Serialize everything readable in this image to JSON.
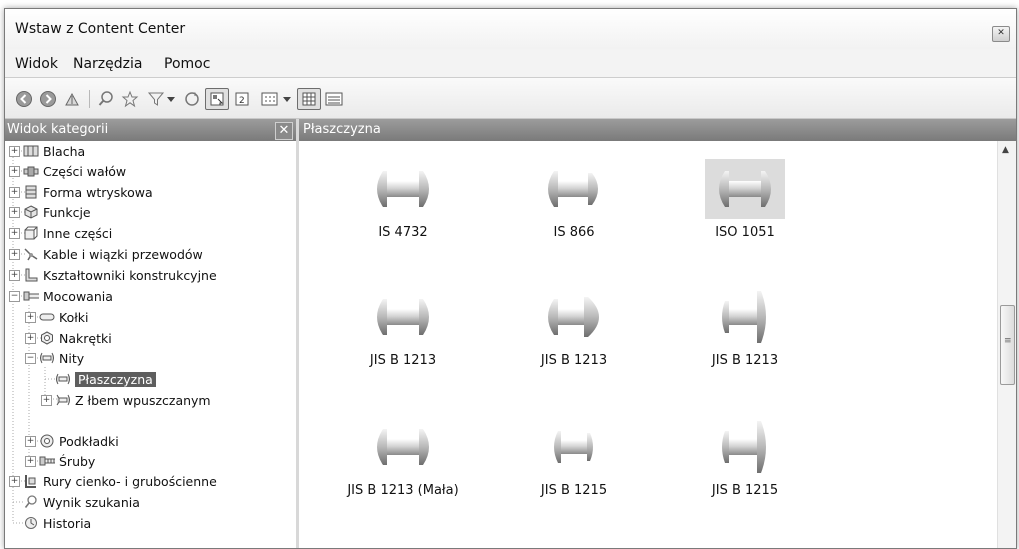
{
  "window": {
    "title": "Wstaw z Content Center",
    "close_glyph": "✕"
  },
  "menu": [
    "Widok",
    "Narzędzia",
    "Pomoc"
  ],
  "toolbar": {
    "buttons": [
      "back-icon",
      "forward-icon",
      "up-folder-icon",
      "search-icon",
      "favorites-star-icon",
      "filter-icon",
      "filter-dropdown-icon",
      "refresh-icon",
      "tree-view-toggle-icon",
      "table-view-icon",
      "view-mode-dropdown-icon",
      "thumbnail-view-icon",
      "list-view-icon"
    ]
  },
  "left_panel": {
    "title": "Widok kategorii",
    "close_glyph": "✕",
    "tree": [
      {
        "label": "Blacha",
        "expander": "+",
        "selected": false
      },
      {
        "label": "Części wałów",
        "expander": "+",
        "selected": false
      },
      {
        "label": "Forma wtryskowa",
        "expander": "+",
        "selected": false
      },
      {
        "label": "Funkcje",
        "expander": "+",
        "selected": false
      },
      {
        "label": "Inne części",
        "expander": "+",
        "selected": false
      },
      {
        "label": "Kable i wiązki przewodów",
        "expander": "+",
        "selected": false
      },
      {
        "label": "Kształtowniki konstrukcyjne",
        "expander": "+",
        "selected": false
      },
      {
        "label": "Mocowania",
        "expander": "−",
        "selected": false
      },
      {
        "label": "Kołki",
        "expander": "+",
        "selected": false
      },
      {
        "label": "Nakrętki",
        "expander": "+",
        "selected": false
      },
      {
        "label": "Nity",
        "expander": "−",
        "selected": false
      },
      {
        "label": "Płaszczyzna",
        "expander": "",
        "selected": true
      },
      {
        "label": "Z łbem wpuszczanym",
        "expander": "+",
        "selected": false
      },
      {
        "label": "Podkładki",
        "expander": "+",
        "selected": false
      },
      {
        "label": "Śruby",
        "expander": "+",
        "selected": false
      },
      {
        "label": "Rury cienko- i grubościenne",
        "expander": "+",
        "selected": false
      },
      {
        "label": "Wynik szukania",
        "expander": "",
        "selected": false
      },
      {
        "label": "Historia",
        "expander": "",
        "selected": false
      }
    ]
  },
  "right_panel": {
    "title": "Płaszczyzna",
    "items": [
      {
        "label": "IS 4732",
        "selected": false
      },
      {
        "label": "IS 866",
        "selected": false
      },
      {
        "label": "ISO 1051",
        "selected": true
      },
      {
        "label": "JIS B 1213",
        "selected": false
      },
      {
        "label": "JIS B 1213",
        "selected": false
      },
      {
        "label": "JIS B 1213",
        "selected": false
      },
      {
        "label": "JIS B 1213 (Mała)",
        "selected": false
      },
      {
        "label": "JIS B 1215",
        "selected": false
      },
      {
        "label": "JIS B 1215",
        "selected": false
      }
    ]
  }
}
